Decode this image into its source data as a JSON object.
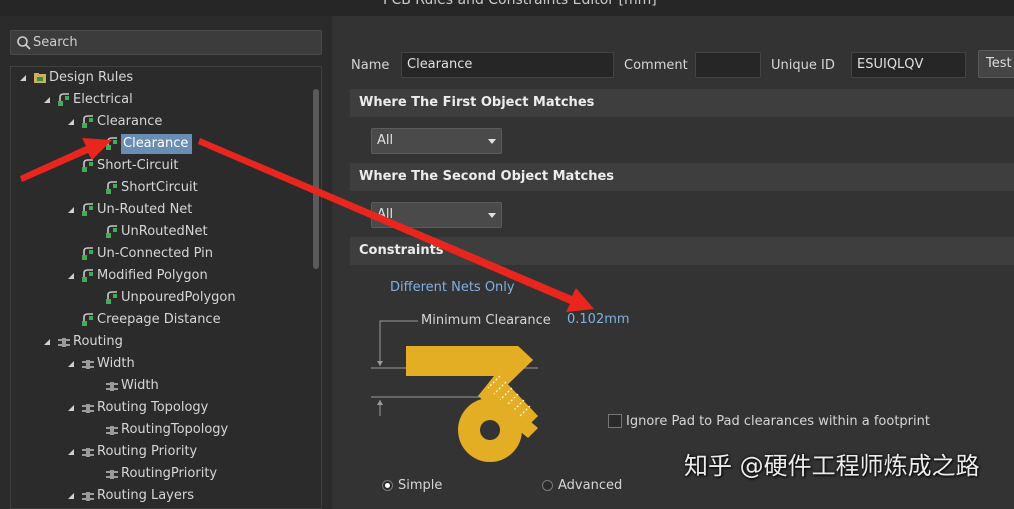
{
  "window": {
    "title": "PCB Rules and Constraints Editor [mm]"
  },
  "search": {
    "placeholder": "Search"
  },
  "tree": {
    "items": [
      {
        "label": "Design Rules",
        "level": 0,
        "expanded": true,
        "icon": "folder-rules-icon"
      },
      {
        "label": "Electrical",
        "level": 1,
        "expanded": true,
        "icon": "rule-category-icon"
      },
      {
        "label": "Clearance",
        "level": 2,
        "expanded": true,
        "icon": "rule-category-icon"
      },
      {
        "label": "Clearance",
        "level": 3,
        "selected": true,
        "icon": "rule-icon"
      },
      {
        "label": "Short-Circuit",
        "level": 2,
        "expanded": false,
        "icon": "rule-category-icon"
      },
      {
        "label": "ShortCircuit",
        "level": 3,
        "icon": "rule-icon"
      },
      {
        "label": "Un-Routed Net",
        "level": 2,
        "expanded": true,
        "icon": "rule-category-icon"
      },
      {
        "label": "UnRoutedNet",
        "level": 3,
        "icon": "rule-icon"
      },
      {
        "label": "Un-Connected Pin",
        "level": 2,
        "expanded": false,
        "icon": "rule-category-icon"
      },
      {
        "label": "Modified Polygon",
        "level": 2,
        "expanded": true,
        "icon": "rule-category-icon"
      },
      {
        "label": "UnpouredPolygon",
        "level": 3,
        "icon": "rule-icon"
      },
      {
        "label": "Creepage Distance",
        "level": 2,
        "expanded": false,
        "icon": "rule-category-icon"
      },
      {
        "label": "Routing",
        "level": 1,
        "expanded": true,
        "icon": "routing-category-icon"
      },
      {
        "label": "Width",
        "level": 2,
        "expanded": true,
        "icon": "routing-category-icon"
      },
      {
        "label": "Width",
        "level": 3,
        "icon": "routing-rule-icon"
      },
      {
        "label": "Routing Topology",
        "level": 2,
        "expanded": true,
        "icon": "routing-category-icon"
      },
      {
        "label": "RoutingTopology",
        "level": 3,
        "icon": "routing-rule-icon"
      },
      {
        "label": "Routing Priority",
        "level": 2,
        "expanded": true,
        "icon": "routing-category-icon"
      },
      {
        "label": "RoutingPriority",
        "level": 3,
        "icon": "routing-rule-icon"
      },
      {
        "label": "Routing Layers",
        "level": 2,
        "expanded": true,
        "icon": "routing-category-icon"
      }
    ]
  },
  "rule": {
    "name_label": "Name",
    "name_value": "Clearance",
    "comment_label": "Comment",
    "comment_value": "",
    "unique_id_label": "Unique ID",
    "unique_id_value": "ESUIQLQV",
    "test_button": "Test"
  },
  "first_match": {
    "header": "Where The First Object Matches",
    "selected": "All"
  },
  "second_match": {
    "header": "Where The Second Object Matches",
    "selected": "All"
  },
  "constraints": {
    "header": "Constraints",
    "net_scope": "Different Nets Only",
    "min_clearance_label": "Minimum Clearance",
    "min_clearance_value": "0.102mm",
    "ignore_pad_label": "Ignore Pad to Pad clearances within a footprint",
    "ignore_pad_checked": false,
    "mode_simple": "Simple",
    "mode_advanced": "Advanced",
    "mode_selected": "Simple"
  },
  "watermark": "知乎 @硬件工程师炼成之路",
  "colors": {
    "accent_selected": "#6a8eb3",
    "link_blue": "#7fb1e0",
    "copper": "#e3ae23",
    "annotation_red": "#e8261d"
  }
}
